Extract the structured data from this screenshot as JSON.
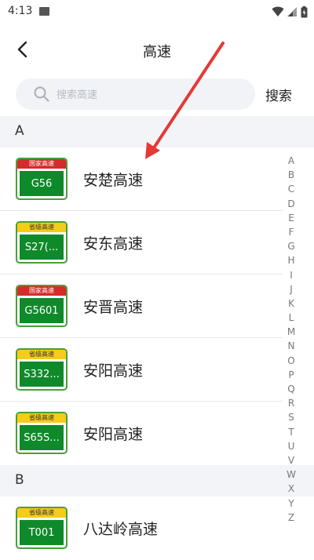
{
  "status": {
    "time": "4:13"
  },
  "header": {
    "title": "高速"
  },
  "search": {
    "placeholder": "搜索高速",
    "button": "搜索"
  },
  "sections": [
    {
      "letter": "A",
      "items": [
        {
          "badge_type": "国家高速",
          "badge_kind": "national",
          "code": "G56",
          "name": "安楚高速"
        },
        {
          "badge_type": "省级高速",
          "badge_kind": "provincial",
          "code": "S27(...",
          "name": "安东高速"
        },
        {
          "badge_type": "国家高速",
          "badge_kind": "national",
          "code": "G5601",
          "name": "安晋高速"
        },
        {
          "badge_type": "省级高速",
          "badge_kind": "provincial",
          "code": "S332...",
          "name": "安阳高速"
        },
        {
          "badge_type": "省级高速",
          "badge_kind": "provincial",
          "code": "S65S...",
          "name": "安阳高速"
        }
      ]
    },
    {
      "letter": "B",
      "items": [
        {
          "badge_type": "省级高速",
          "badge_kind": "provincial",
          "code": "T001",
          "name": "八达岭高速"
        }
      ]
    }
  ],
  "alphabet": [
    "A",
    "B",
    "C",
    "D",
    "E",
    "F",
    "G",
    "H",
    "I",
    "J",
    "K",
    "L",
    "M",
    "N",
    "O",
    "P",
    "Q",
    "R",
    "S",
    "T",
    "U",
    "V",
    "W",
    "X",
    "Y",
    "Z"
  ],
  "colors": {
    "national_badge": "#d42b2b",
    "provincial_badge": "#f5cc18",
    "plate_green": "#0f8a2a",
    "annotation_arrow": "#e53935"
  }
}
